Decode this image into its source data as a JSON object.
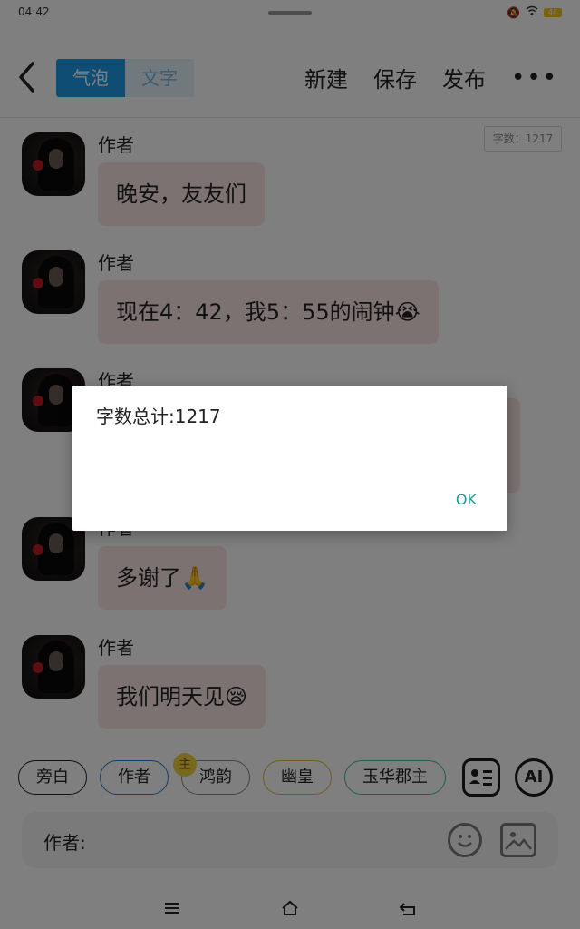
{
  "status_bar": {
    "time": "04:42",
    "battery": "44"
  },
  "header": {
    "back_icon": "back-arrow-icon",
    "segments": [
      "气泡",
      "文字"
    ],
    "actions": [
      "新建",
      "保存",
      "发布"
    ],
    "more_icon": "more-icon"
  },
  "word_count_chip": "字数：1217",
  "messages": [
    {
      "author": "作者",
      "text": "晚安，友友们"
    },
    {
      "author": "作者",
      "text": "现在4：42，我5：55的闹钟😭"
    },
    {
      "author": "作者",
      "text": ""
    },
    {
      "author": "作者",
      "text": "多谢了🙏"
    },
    {
      "author": "作者",
      "text": "我们明天见😪"
    }
  ],
  "chips": [
    "旁白",
    "作者",
    "鸿韵",
    "幽皇",
    "玉华郡主"
  ],
  "chip_badge": "主",
  "colors": {
    "accent_blue": "#1e9ae8",
    "bubble_pink": "#fbe5e5",
    "ok_teal": "#1a9c94",
    "chip_narrator": "#222222",
    "chip_author": "#2b7cd3",
    "chip_hongyun": "#888888",
    "chip_youhuang": "#e0b43a",
    "chip_yuhua": "#4bb6a4"
  },
  "input": {
    "label": "作者:"
  },
  "dialog": {
    "text": "字数总计:1217",
    "ok_label": "OK"
  },
  "nav": {
    "menu_icon": "menu-icon",
    "home_icon": "home-icon",
    "back_icon": "back-icon"
  }
}
